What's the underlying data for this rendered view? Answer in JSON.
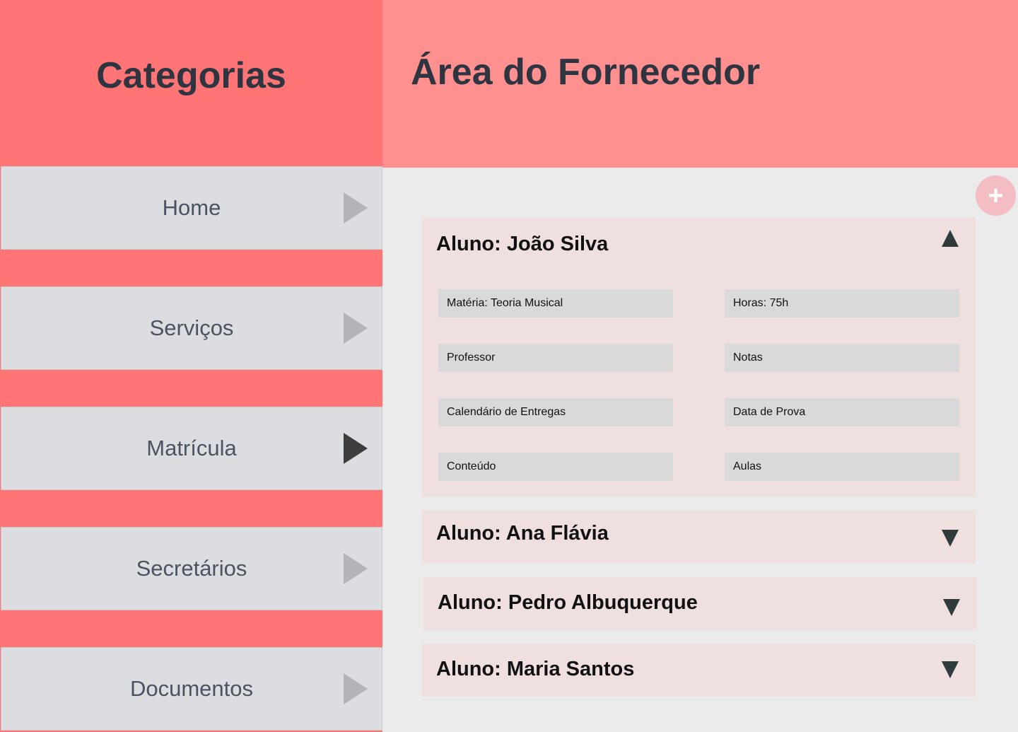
{
  "sidebar": {
    "title": "Categorias",
    "items": [
      {
        "label": "Home",
        "active": false
      },
      {
        "label": "Serviços",
        "active": false
      },
      {
        "label": "Matrícula",
        "active": true
      },
      {
        "label": "Secretários",
        "active": false
      },
      {
        "label": "Documentos",
        "active": false
      }
    ]
  },
  "header": {
    "title": "Área do Fornecedor"
  },
  "add_button": {
    "icon": "plus-icon",
    "symbol": "+"
  },
  "students": [
    {
      "title": "Aluno: João Silva",
      "expanded": true,
      "fields": [
        "Matéria: Teoria Musical",
        "Horas: 75h",
        "Professor",
        "Notas",
        "Calendário de Entregas",
        "Data de Prova",
        "Conteúdo",
        "Aulas"
      ]
    },
    {
      "title": "Aluno: Ana Flávia",
      "expanded": false
    },
    {
      "title": "Aluno: Pedro Albuquerque",
      "expanded": false
    },
    {
      "title": "Aluno: Maria Santos",
      "expanded": false
    }
  ],
  "colors": {
    "sidebar_bg": "#ff7474",
    "header_bg": "#ff9090",
    "nav_item_bg": "#dcdde0",
    "panel_bg": "#efdfdf",
    "field_bg": "#d9d9d9",
    "add_button_bg": "#f4bcc3"
  }
}
